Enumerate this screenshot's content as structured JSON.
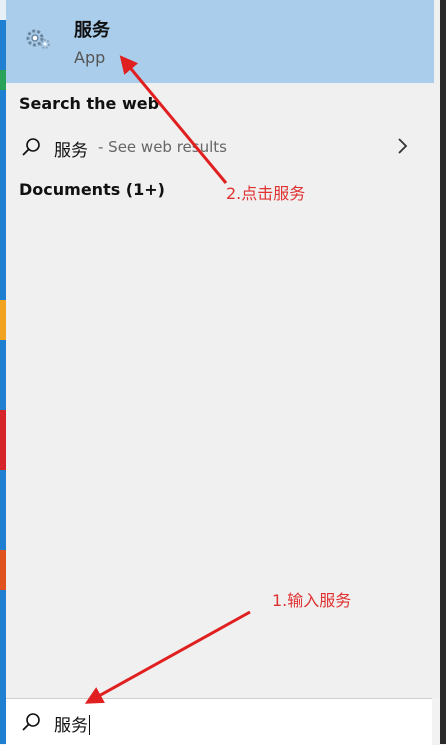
{
  "best_match": {
    "title": "服务",
    "subtitle": "App"
  },
  "search_web": {
    "heading": "Search the web",
    "term": "服务",
    "hint": "- See web results"
  },
  "documents": {
    "heading": "Documents (1+)"
  },
  "annotations": {
    "step2": "2.点击服务",
    "step1": "1.输入服务"
  },
  "search_box": {
    "query": "服务"
  },
  "colors": {
    "highlight": "#a9cdea",
    "panel": "#f0f0f0",
    "annotation": "#e03131"
  }
}
